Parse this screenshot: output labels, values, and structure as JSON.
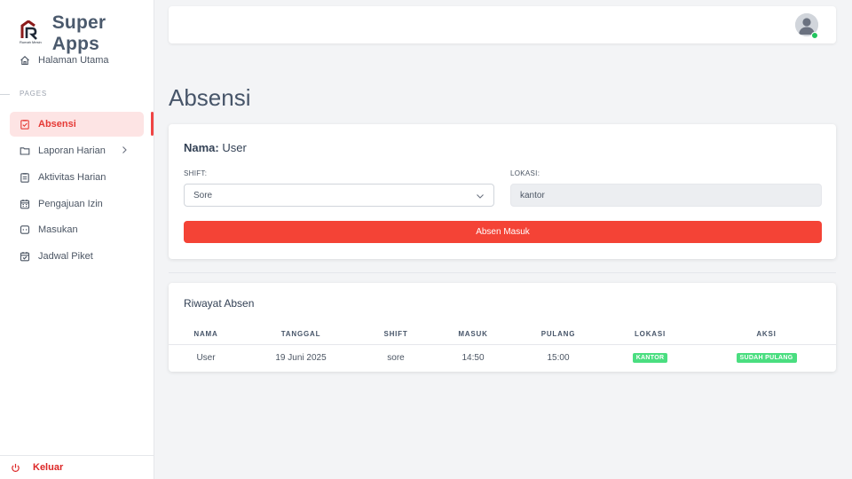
{
  "brand": {
    "title": "Super Apps",
    "logo_text": "Rumah Mesin",
    "accent": "#e53935"
  },
  "sidebar": {
    "home": {
      "label": "Halaman Utama",
      "icon": "home-icon"
    },
    "section_label": "PAGES",
    "items": [
      {
        "label": "Absensi",
        "icon": "clipboard-check-icon",
        "active": true
      },
      {
        "label": "Laporan Harian",
        "icon": "folder-icon",
        "has_submenu": true
      },
      {
        "label": "Aktivitas Harian",
        "icon": "clipboard-list-icon"
      },
      {
        "label": "Pengajuan Izin",
        "icon": "calendar-icon"
      },
      {
        "label": "Masukan",
        "icon": "chat-icon"
      },
      {
        "label": "Jadwal Piket",
        "icon": "calendar-check-icon"
      }
    ],
    "logout": {
      "label": "Keluar",
      "icon": "power-icon"
    }
  },
  "page": {
    "title": "Absensi"
  },
  "form": {
    "name_label": "Nama:",
    "name_value": "User",
    "shift_label": "SHIFT:",
    "shift_value": "Sore",
    "location_label": "LOKASI:",
    "location_value": "kantor",
    "submit_label": "Absen Masuk"
  },
  "history": {
    "title": "Riwayat Absen",
    "columns": [
      "NAMA",
      "TANGGAL",
      "SHIFT",
      "MASUK",
      "PULANG",
      "LOKASI",
      "AKSI"
    ],
    "rows": [
      {
        "nama": "User",
        "tanggal": "19 Juni 2025",
        "shift": "sore",
        "masuk": "14:50",
        "pulang": "15:00",
        "lokasi": "KANTOR",
        "aksi": "SUDAH PULANG"
      }
    ]
  },
  "colors": {
    "primary": "#f44336",
    "success": "#4ade80",
    "online": "#22c55e"
  }
}
